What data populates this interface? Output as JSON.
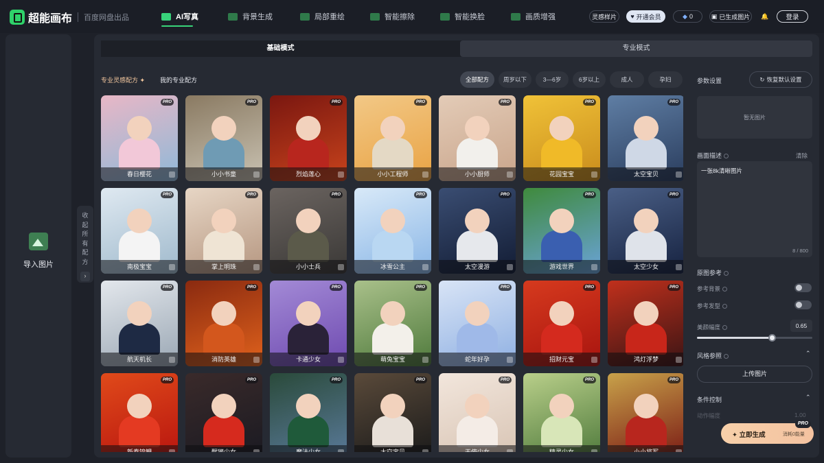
{
  "brand": {
    "name": "超能画布",
    "sub": "百度网盘出品"
  },
  "nav": [
    {
      "label": "AI写真",
      "active": true,
      "icon": "camera-icon"
    },
    {
      "label": "背景生成",
      "active": false,
      "icon": "mountain-icon"
    },
    {
      "label": "局部重绘",
      "active": false,
      "icon": "brush-icon"
    },
    {
      "label": "智能擦除",
      "active": false,
      "icon": "eraser-icon"
    },
    {
      "label": "智能换脸",
      "active": false,
      "icon": "face-swap-icon"
    },
    {
      "label": "画质增强",
      "active": false,
      "icon": "enhance-icon"
    }
  ],
  "topright": {
    "inspire": "灵感样片",
    "vip": "开通会员",
    "coins": "0",
    "generated": "已生成图片",
    "login": "登录"
  },
  "left": {
    "import_label": "导入图片",
    "collapse_text": [
      "收",
      "起",
      "所",
      "有",
      "配",
      "方"
    ]
  },
  "mode_tabs": [
    "基础模式",
    "专业模式"
  ],
  "recipe_tabs": [
    "专业灵感配方",
    "我的专业配方"
  ],
  "age_chips": [
    "全部配方",
    "周岁以下",
    "3—6岁",
    "6岁以上",
    "成人",
    "孕妇"
  ],
  "pro_badge": "PRO",
  "cards": [
    {
      "name": "春日樱花",
      "bg": "#8fb8d8",
      "bg2": "#e8b7c6",
      "outfit": "#f2c8d8"
    },
    {
      "name": "小小书童",
      "bg": "#c9c2b2",
      "bg2": "#8a7a62",
      "outfit": "#6f9bb4"
    },
    {
      "name": "烈焰莲心",
      "bg": "#c8431c",
      "bg2": "#7a1710",
      "outfit": "#b8261e"
    },
    {
      "name": "小小工程师",
      "bg": "#e9a344",
      "bg2": "#f2c886",
      "outfit": "#e4d9c5"
    },
    {
      "name": "小小厨师",
      "bg": "#c9a58b",
      "bg2": "#e3cbb7",
      "outfit": "#f2f0ec"
    },
    {
      "name": "花园宝宝",
      "bg": "#c98c1c",
      "bg2": "#f0c238",
      "outfit": "#f0ba28"
    },
    {
      "name": "太空宝贝",
      "bg": "#2a3d5e",
      "bg2": "#5f7ea4",
      "outfit": "#cfd8e6"
    },
    {
      "name": "南极宝宝",
      "bg": "#9fb9cc",
      "bg2": "#dfe9f1",
      "outfit": "#f4f4f4"
    },
    {
      "name": "掌上明珠",
      "bg": "#b59680",
      "bg2": "#e7d6c5",
      "outfit": "#efe4d4"
    },
    {
      "name": "小小士兵",
      "bg": "#3a3836",
      "bg2": "#6b6460",
      "outfit": "#5b5a4a"
    },
    {
      "name": "冰雪公主",
      "bg": "#8ab6e6",
      "bg2": "#d8e9f8",
      "outfit": "#b9d7f2"
    },
    {
      "name": "太空漫游",
      "bg": "#121c34",
      "bg2": "#3a4d72",
      "outfit": "#e6e8ec"
    },
    {
      "name": "游戏世界",
      "bg": "#6aa3d8",
      "bg2": "#3f8a3c",
      "outfit": "#3a5fb0"
    },
    {
      "name": "太空少女",
      "bg": "#162240",
      "bg2": "#4a5f86",
      "outfit": "#dfe3ea"
    },
    {
      "name": "航天机长",
      "bg": "#9aa7b4",
      "bg2": "#e3e7ec",
      "outfit": "#1e2a44"
    },
    {
      "name": "消防英雄",
      "bg": "#e0621c",
      "bg2": "#8a2a10",
      "outfit": "#d3571d"
    },
    {
      "name": "卡通少女",
      "bg": "#6e4ab0",
      "bg2": "#a38ad6",
      "outfit": "#2a2238"
    },
    {
      "name": "萌兔宝宝",
      "bg": "#4f7a3c",
      "bg2": "#a9c08a",
      "outfit": "#f3f0ea"
    },
    {
      "name": "蛇年好孕",
      "bg": "#8fb0e2",
      "bg2": "#d8e4f6",
      "outfit": "#9fb9e8"
    },
    {
      "name": "招财元宝",
      "bg": "#a8140f",
      "bg2": "#d63a1e",
      "outfit": "#d42a1e"
    },
    {
      "name": "鸿灯浮梦",
      "bg": "#3a1414",
      "bg2": "#c0301c",
      "outfit": "#c8261a"
    },
    {
      "name": "新春锦鲤",
      "bg": "#b8150f",
      "bg2": "#e04a1a",
      "outfit": "#e43a22"
    },
    {
      "name": "醒狮少女",
      "bg": "#1a1a22",
      "bg2": "#3a2a2a",
      "outfit": "#d62a1e"
    },
    {
      "name": "魔法少女",
      "bg": "#5a7a9a",
      "bg2": "#2a4a3a",
      "outfit": "#1f5a3a"
    },
    {
      "name": "太空宝贝",
      "bg": "#1a1a1a",
      "bg2": "#5a4a3a",
      "outfit": "#e8e0d8"
    },
    {
      "name": "天使少女",
      "bg": "#d8c4b4",
      "bg2": "#f2e6dc",
      "outfit": "#f4ece6"
    },
    {
      "name": "精灵少女",
      "bg": "#4f7a3c",
      "bg2": "#b9cf8a",
      "outfit": "#d8e6b8"
    },
    {
      "name": "小小将军",
      "bg": "#7a1a14",
      "bg2": "#c8a24a",
      "outfit": "#b8261e"
    }
  ],
  "right": {
    "params_title": "参数设置",
    "reset": "恢复默认设置",
    "no_image": "暂无图片",
    "desc_title": "画面描述",
    "clear": "清除",
    "desc_text": "一张8k清晰图片",
    "char_count": "8 / 800",
    "ref_title": "原图参考",
    "ref_bg": "参考背景",
    "ref_hair": "参考发型",
    "beauty_label": "美颜幅度",
    "beauty_value": "0.65",
    "beauty_level": 0.65,
    "style_title": "风格参照",
    "upload": "上传图片",
    "cond_title": "条件控制",
    "action_label": "动作幅度",
    "action_value": "1.00",
    "generate": "立即生成",
    "consume": "消耗0能量",
    "pro": "PRO"
  },
  "colors": {
    "accent": "#39d57a",
    "generate_bg": "#f7c9a8"
  }
}
